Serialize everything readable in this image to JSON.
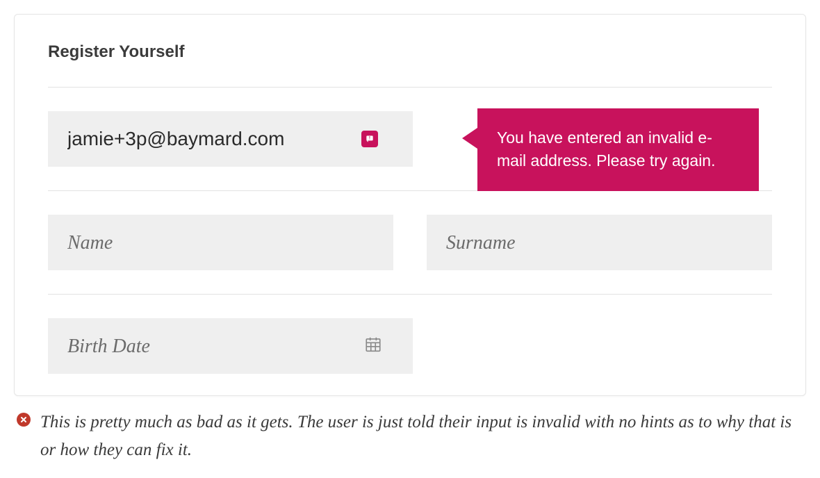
{
  "form": {
    "title": "Register Yourself",
    "email": {
      "value": "jamie+3p@baymard.com",
      "error_message": "You have entered an invalid e-mail address. Please try again."
    },
    "name_placeholder": "Name",
    "surname_placeholder": "Surname",
    "birthdate_placeholder": "Birth Date"
  },
  "caption": {
    "text": "This is pretty much as bad as it gets. The user is just told their input is invalid with no hints as to why that is or how they can fix it."
  }
}
